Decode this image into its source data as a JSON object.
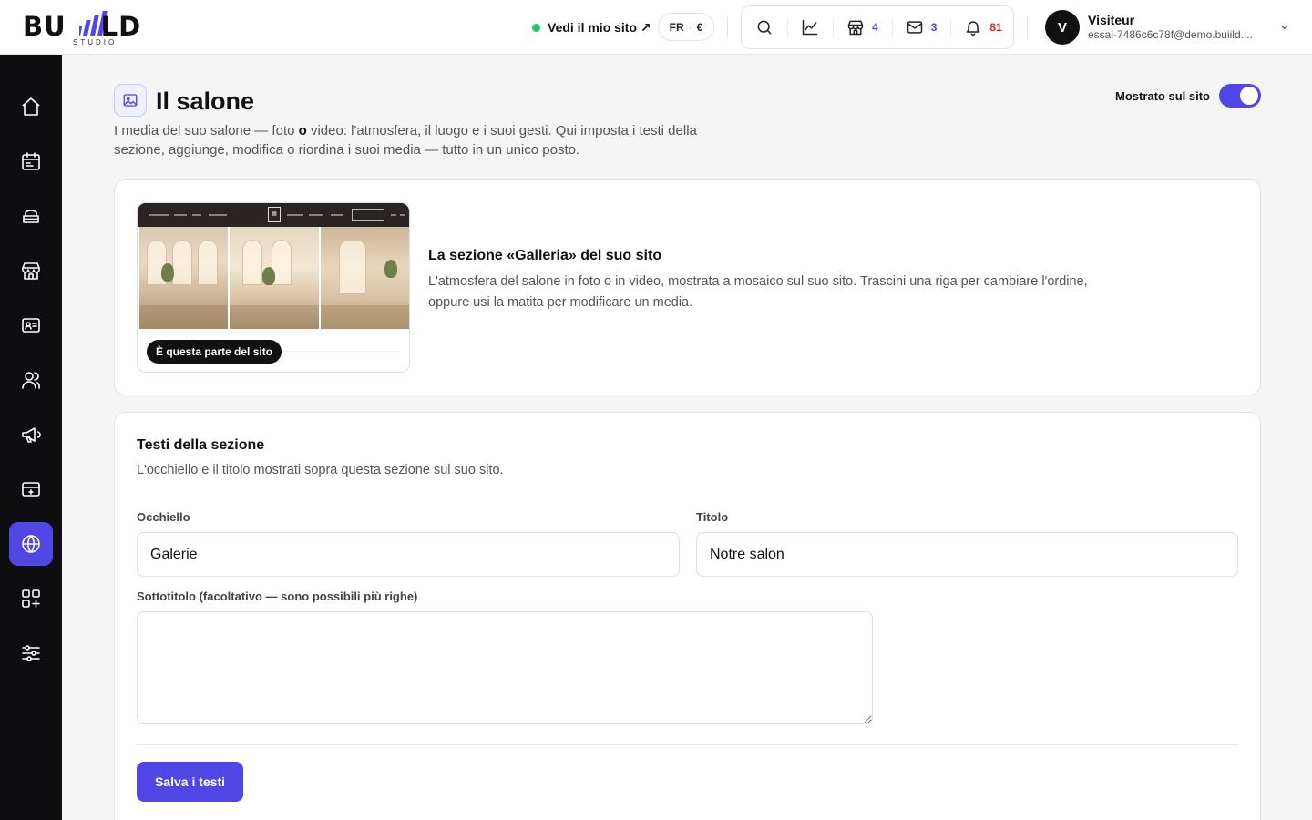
{
  "brand": {
    "word": "BUILD",
    "sub": "STUDIO",
    "accent": "#4f46e5"
  },
  "header": {
    "site_link": "Vedi il mio sito ↗",
    "lang": "FR",
    "currency": "€",
    "toolbar": {
      "search_icon": "search-icon",
      "stats_icon": "chart-line-icon",
      "shop_count": "4",
      "mail_count": "3",
      "notif_count": "81"
    },
    "user": {
      "initial": "V",
      "name": "Visiteur",
      "email": "essai-7486c6c78f@demo.buiild...."
    }
  },
  "sidebar": {
    "items": [
      {
        "icon": "home-icon"
      },
      {
        "icon": "calendar-icon"
      },
      {
        "icon": "services-icon"
      },
      {
        "icon": "store-icon"
      },
      {
        "icon": "contact-card-icon"
      },
      {
        "icon": "users-icon"
      },
      {
        "icon": "megaphone-icon"
      },
      {
        "icon": "payment-card-icon"
      },
      {
        "icon": "globe-icon",
        "active": true
      },
      {
        "icon": "apps-plus-icon"
      },
      {
        "icon": "sliders-icon"
      }
    ]
  },
  "page": {
    "title": "Il salone",
    "desc_before": "I media del suo salone — foto ",
    "desc_bold": "o",
    "desc_after": " video: l'atmosfera, il luogo e i suoi gesti. Qui imposta i testi della sezione, aggiunge, modifica o riordina i suoi media — tutto in un unico posto.",
    "toggle_label": "Mostrato sul sito",
    "toggle_on": true
  },
  "section_card": {
    "badge": "È questa parte del sito",
    "title": "La sezione «Galleria» del suo sito",
    "desc": "L'atmosfera del salone in foto o in video, mostrata a mosaico sul suo sito. Trascini una riga per cambiare l'ordine, oppure usi la matita per modificare un media."
  },
  "texts_card": {
    "title": "Testi della sezione",
    "desc": "L'occhiello e il titolo mostrati sopra questa sezione sul suo sito.",
    "eyebrow_label": "Occhiello",
    "eyebrow_value": "Galerie",
    "title_label": "Titolo",
    "title_value": "Notre salon",
    "subtitle_label": "Sottotitolo (facoltativo — sono possibili più righe)",
    "subtitle_value": "",
    "save_label": "Salva i testi"
  }
}
